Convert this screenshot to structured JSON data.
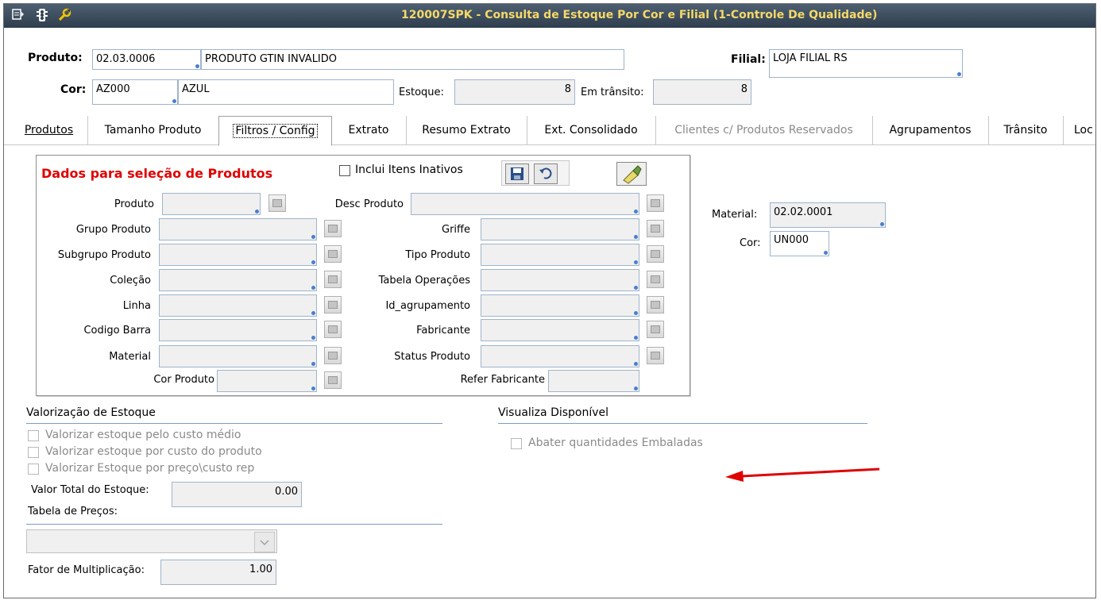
{
  "window": {
    "title": "120007SPK - Consulta de Estoque Por Cor e Filial (1-Controle De Qualidade)"
  },
  "header": {
    "produto_label": "Produto:",
    "produto_code": "02.03.0006",
    "produto_desc": "PRODUTO GTIN INVALIDO",
    "filial_label": "Filial:",
    "filial_value": "LOJA FILIAL RS",
    "cor_label": "Cor:",
    "cor_code": "AZ000",
    "cor_desc": "AZUL",
    "estoque_label": "Estoque:",
    "estoque_value": "8",
    "transito_label": "Em trânsito:",
    "transito_value": "8"
  },
  "tabs": [
    {
      "label": "Produtos"
    },
    {
      "label": "Tamanho Produto"
    },
    {
      "label": "Filtros / Config"
    },
    {
      "label": "Extrato"
    },
    {
      "label": "Resumo Extrato"
    },
    {
      "label": "Ext. Consolidado"
    },
    {
      "label": "Clientes c/ Produtos Reservados"
    },
    {
      "label": "Agrupamentos"
    },
    {
      "label": "Trânsito"
    },
    {
      "label": "Loc"
    }
  ],
  "filters": {
    "title": "Dados para seleção de Produtos",
    "inclui_label": "Inclui Itens Inativos",
    "left": [
      "Produto",
      "Grupo Produto",
      "Subgrupo Produto",
      "Coleção",
      "Linha",
      "Codigo Barra",
      "Material",
      "Cor Produto"
    ],
    "right": [
      "Desc Produto",
      "Griffe",
      "Tipo Produto",
      "Tabela Operações",
      "Id_agrupamento",
      "Fabricante",
      "Status Produto",
      "Refer Fabricante"
    ]
  },
  "side": {
    "material_label": "Material:",
    "material_value": "02.02.0001",
    "cor_label": "Cor:",
    "cor_value": "UN000"
  },
  "valorizacao": {
    "title": "Valorização de Estoque",
    "opt1": "Valorizar estoque pelo custo médio",
    "opt2": "Valorizar estoque por custo do produto",
    "opt3": "Valorizar Estoque por preço\\custo rep",
    "total_label": "Valor Total do Estoque:",
    "total_value": "0.00",
    "tabela_label": "Tabela de Preços:",
    "fator_label": "Fator de Multiplicação:",
    "fator_value": "1.00"
  },
  "visualiza": {
    "title": "Visualiza Disponível",
    "opt": "Abater quantidades Embaladas"
  },
  "colors": {
    "title_text": "#f5d86a",
    "title_bg": "#3b4a5a",
    "section_title": "#e00000",
    "arrow": "#e00000"
  },
  "icons": [
    "menu-icon",
    "traffic-light-icon",
    "wrench-icon",
    "save-icon",
    "undo-icon",
    "clear-icon",
    "lookup-icon"
  ]
}
